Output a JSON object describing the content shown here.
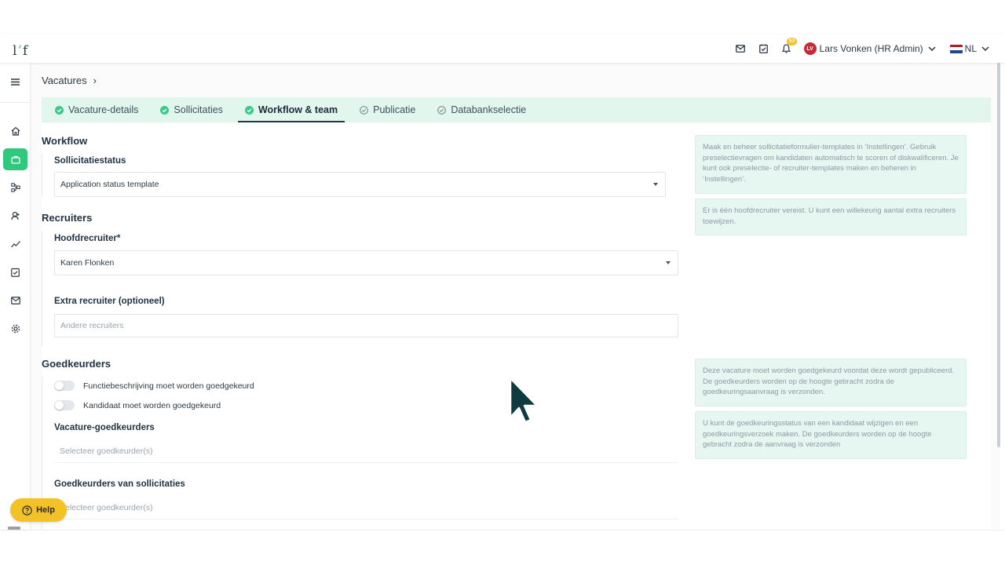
{
  "logo": {
    "text_main": "l",
    "text_accent": "‘",
    "text_tail": "f"
  },
  "header": {
    "notifications_count": "53",
    "user_initials": "LV",
    "user_name": "Lars Vonken (HR Admin)",
    "language": "NL",
    "avatar_color": "#c62a36"
  },
  "sidebar": {
    "items": [
      "menu-icon",
      "home-icon",
      "briefcase-icon",
      "workflow-icon",
      "candidates-icon",
      "analytics-icon",
      "tasks-icon",
      "mail-icon",
      "settings-icon"
    ],
    "active": "briefcase-icon",
    "accent_color": "#2fc87c"
  },
  "breadcrumb": {
    "root": "Vacatures",
    "separator": "›"
  },
  "tabs": [
    {
      "label": "Vacature-details",
      "state": "done"
    },
    {
      "label": "Sollicitaties",
      "state": "done"
    },
    {
      "label": "Workflow & team",
      "state": "active"
    },
    {
      "label": "Publicatie",
      "state": "pending"
    },
    {
      "label": "Databankselectie",
      "state": "pending"
    }
  ],
  "workflow": {
    "title": "Workflow",
    "status_label": "Sollicitatiestatus",
    "status_value": "Application status template",
    "info": "Maak en beheer sollicitatieformulier-templates in ‘Instellingen’. Gebruik preselectievragen om kandidaten automatisch te scoren of diskwalificeren. Je kunt ook preselectie- of recruiter-templates maken en beheren in ‘Instellingen’."
  },
  "recruiters": {
    "title": "Recruiters",
    "main_label": "Hoofdrecruiter*",
    "main_value": "Karen Flonken",
    "extra_label": "Extra recruiter (optioneel)",
    "extra_placeholder": "Andere recruiters",
    "info": "Er is één hoofdrecruiter vereist. U kunt een willekeurig aantal extra recruiters toewijzen."
  },
  "approvers": {
    "title": "Goedkeurders",
    "toggle_job": "Functiebeschrijving moet worden goedgekeurd",
    "toggle_candidate": "Kandidaat moet worden goedgekeurd",
    "vacancy_label": "Vacature-goedkeurders",
    "vacancy_placeholder": "Selecteer goedkeurder(s)",
    "applications_label": "Goedkeurders van sollicitaties",
    "applications_placeholder": "Selecteer goedkeurder(s)",
    "info_vacancy": "Deze vacature moet worden goedgekeurd voordat deze wordt gepubliceerd. De goedkeurders worden op de hoogte gebracht zodra de goedkeuringsaanvraag is verzonden.",
    "info_candidate": "U kunt de goedkeuringsstatus van een kandidaat wijzigen en een goedkeuringsverzoek maken. De goedkeurders worden op de hoogte gebracht zodra de aanvraag is verzonden"
  },
  "help": {
    "label": "Help"
  },
  "colors": {
    "tab_bg": "#e1f7ee",
    "info_bg": "#e6f6f0",
    "check_green": "#3cc88a",
    "help_yellow": "#f3c227"
  }
}
